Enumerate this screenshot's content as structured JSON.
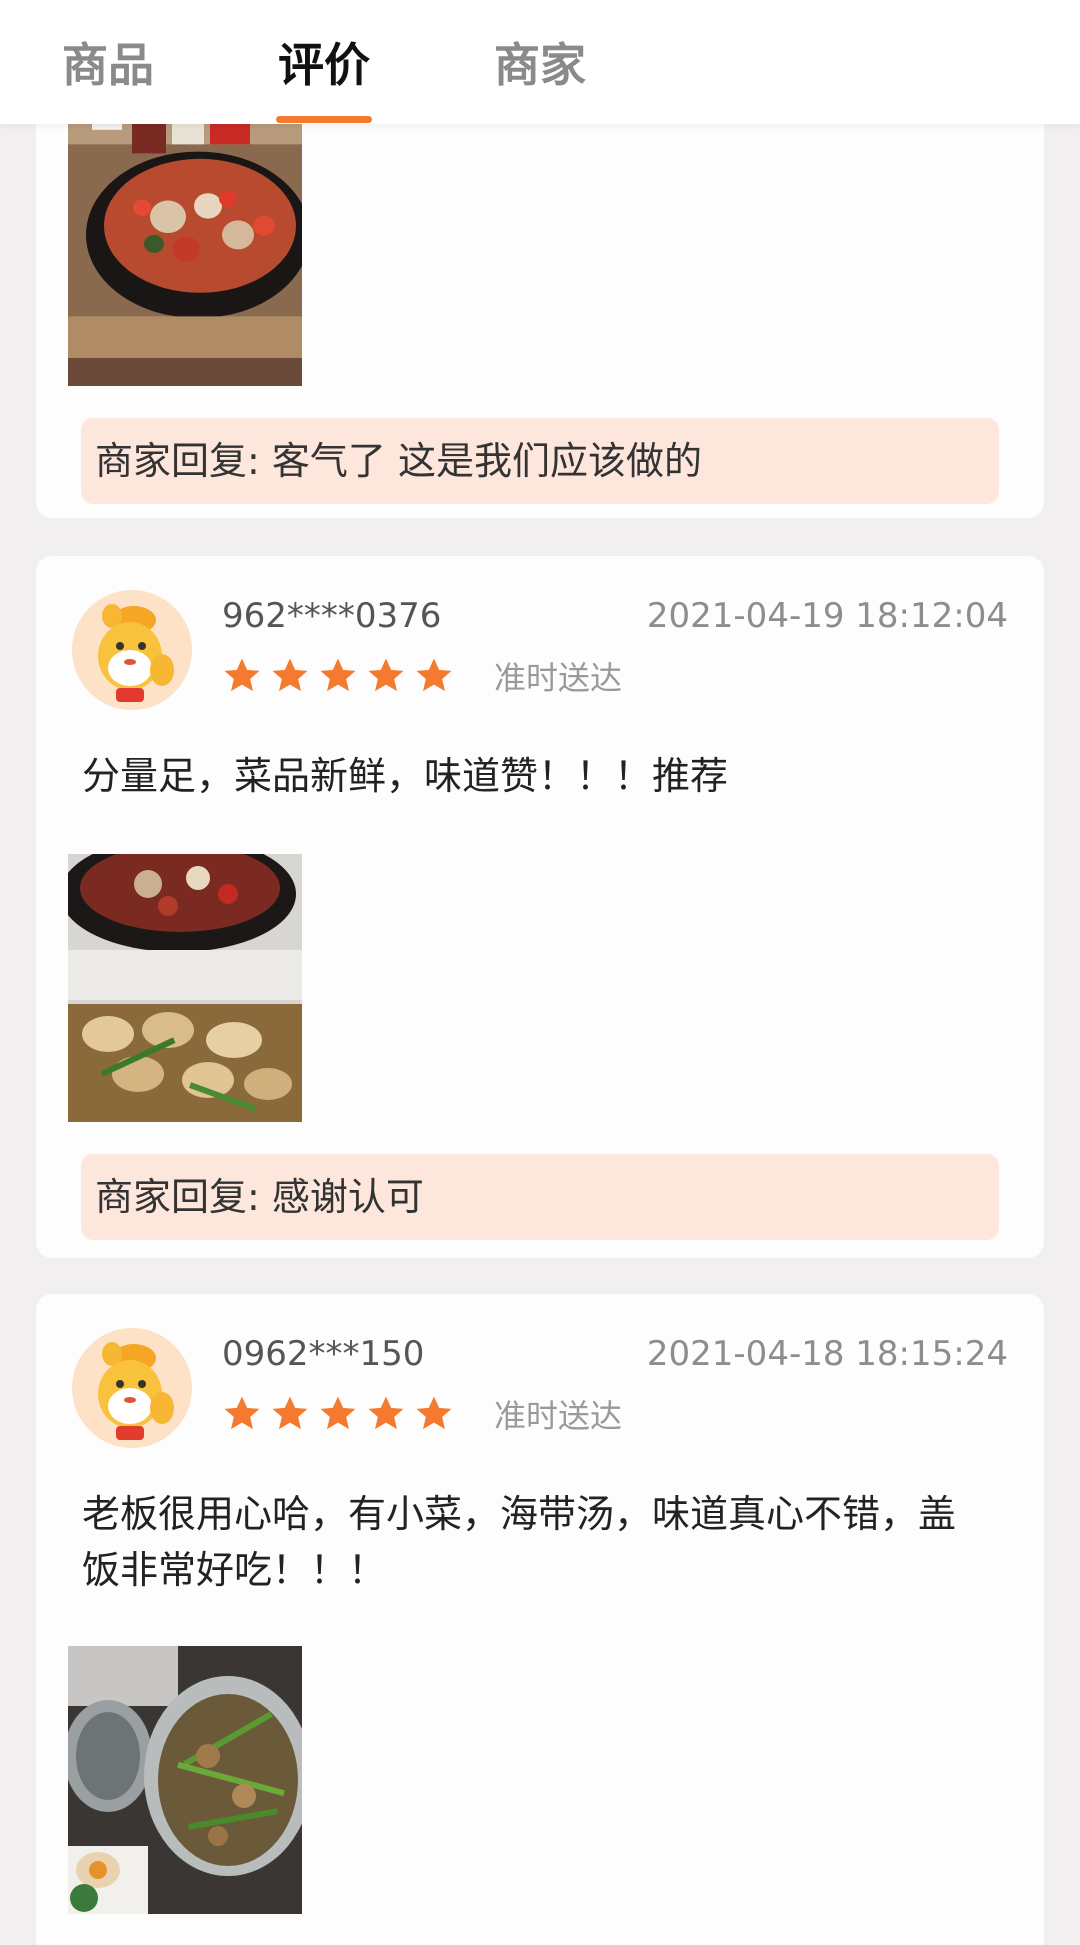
{
  "tabs": [
    {
      "label": "商品",
      "active": false
    },
    {
      "label": "评价",
      "active": true
    },
    {
      "label": "商家",
      "active": false
    }
  ],
  "accent_color": "#f47a30",
  "reply_bg_color": "#fde6dc",
  "reviews": [
    {
      "reply": "商家回复: 客气了 这是我们应该做的",
      "photo_icon": "food-photo"
    },
    {
      "username": "962****0376",
      "timestamp": "2021-04-19 18:12:04",
      "rating": 5,
      "tag": "准时送达",
      "text": "分量足，菜品新鲜，味道赞！！！推荐",
      "reply": "商家回复: 感谢认可",
      "avatar_icon": "cartoon-mascot-avatar",
      "photo_icon": "food-photo"
    },
    {
      "username": "0962***150",
      "timestamp": "2021-04-18 18:15:24",
      "rating": 5,
      "tag": "准时送达",
      "text": "老板很用心哈，有小菜，海带汤，味道真心不错，盖饭非常好吃！！！",
      "avatar_icon": "cartoon-mascot-avatar",
      "photo_icon": "food-photo"
    }
  ]
}
